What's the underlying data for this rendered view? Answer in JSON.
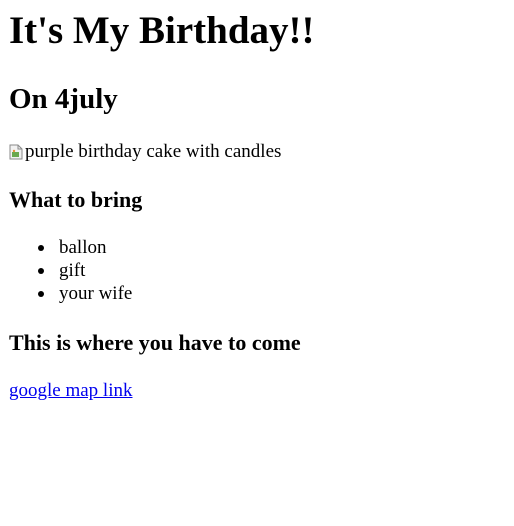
{
  "header": {
    "title": "It's My Birthday!!",
    "date": "On 4july"
  },
  "image": {
    "alt": "purple birthday cake with candles",
    "icon": "broken-image-icon"
  },
  "bring_section": {
    "heading": "What to bring",
    "items": [
      "ballon",
      "gift",
      "your wife"
    ]
  },
  "location_section": {
    "heading": "This is where you have to come",
    "link_text": "google map link"
  },
  "colors": {
    "link": "#0000ee",
    "text": "#000000",
    "background": "#ffffff"
  }
}
